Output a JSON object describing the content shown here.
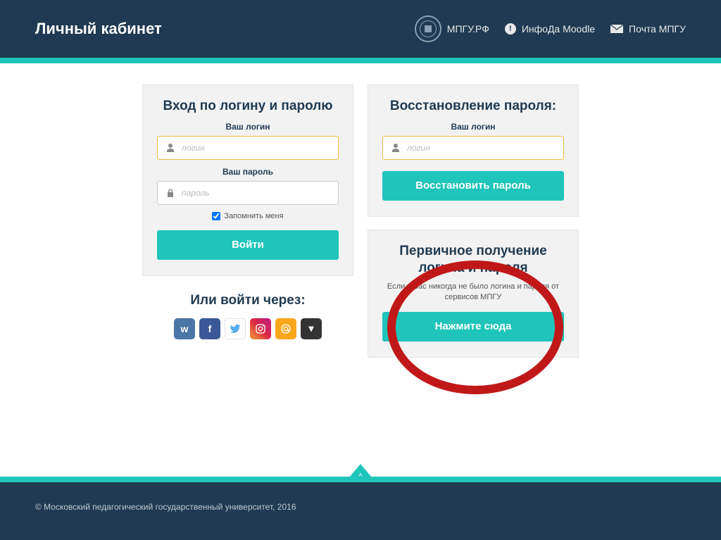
{
  "header": {
    "title": "Личный кабинет",
    "nav": [
      {
        "label": "МПГУ.РФ"
      },
      {
        "label": "ИнфоДа Moodle"
      },
      {
        "label": "Почта МПГУ"
      }
    ]
  },
  "login": {
    "title": "Вход по логину и паролю",
    "loginLabel": "Ваш логин",
    "loginPlaceholder": "логин",
    "passwordLabel": "Ваш пароль",
    "passwordPlaceholder": "пароль",
    "rememberLabel": "Запомнить меня",
    "submit": "Войти"
  },
  "altLogin": {
    "title": "Или войти через:"
  },
  "recover": {
    "title": "Восстановление пароля:",
    "loginLabel": "Ваш логин",
    "loginPlaceholder": "логин",
    "submit": "Восстановить пароль"
  },
  "primary": {
    "title": "Первичное получение логина и пароля",
    "subtitle": "Если у Вас никогда не было логина и пароля от сервисов МПГУ",
    "submit": "Нажмите сюда"
  },
  "footer": {
    "copyright": "© Московский педагогический государственный университет, 2016"
  },
  "icons": {
    "info": "!",
    "caret": "▾",
    "up": "^",
    "vk": "w",
    "fb": "f"
  }
}
